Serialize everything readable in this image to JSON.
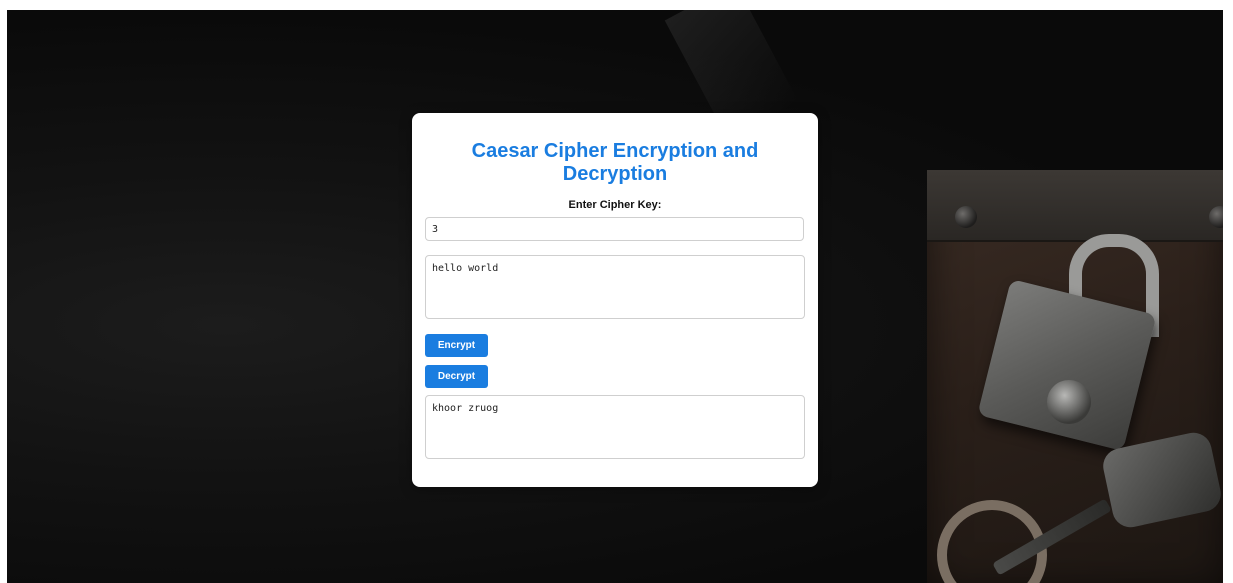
{
  "app": {
    "title": "Caesar Cipher Encryption and Decryption"
  },
  "form": {
    "key_label": "Enter Cipher Key:",
    "key_value": "3",
    "input_text": "hello world",
    "encrypt_label": "Encrypt",
    "decrypt_label": "Decrypt",
    "output_text": "khoor zruog"
  },
  "theme": {
    "accent": "#1a7de0",
    "card_background": "#ffffff",
    "page_background": "#0d0d0d"
  },
  "background": {
    "image_subject": "padlock-and-keys-on-dark-background"
  }
}
